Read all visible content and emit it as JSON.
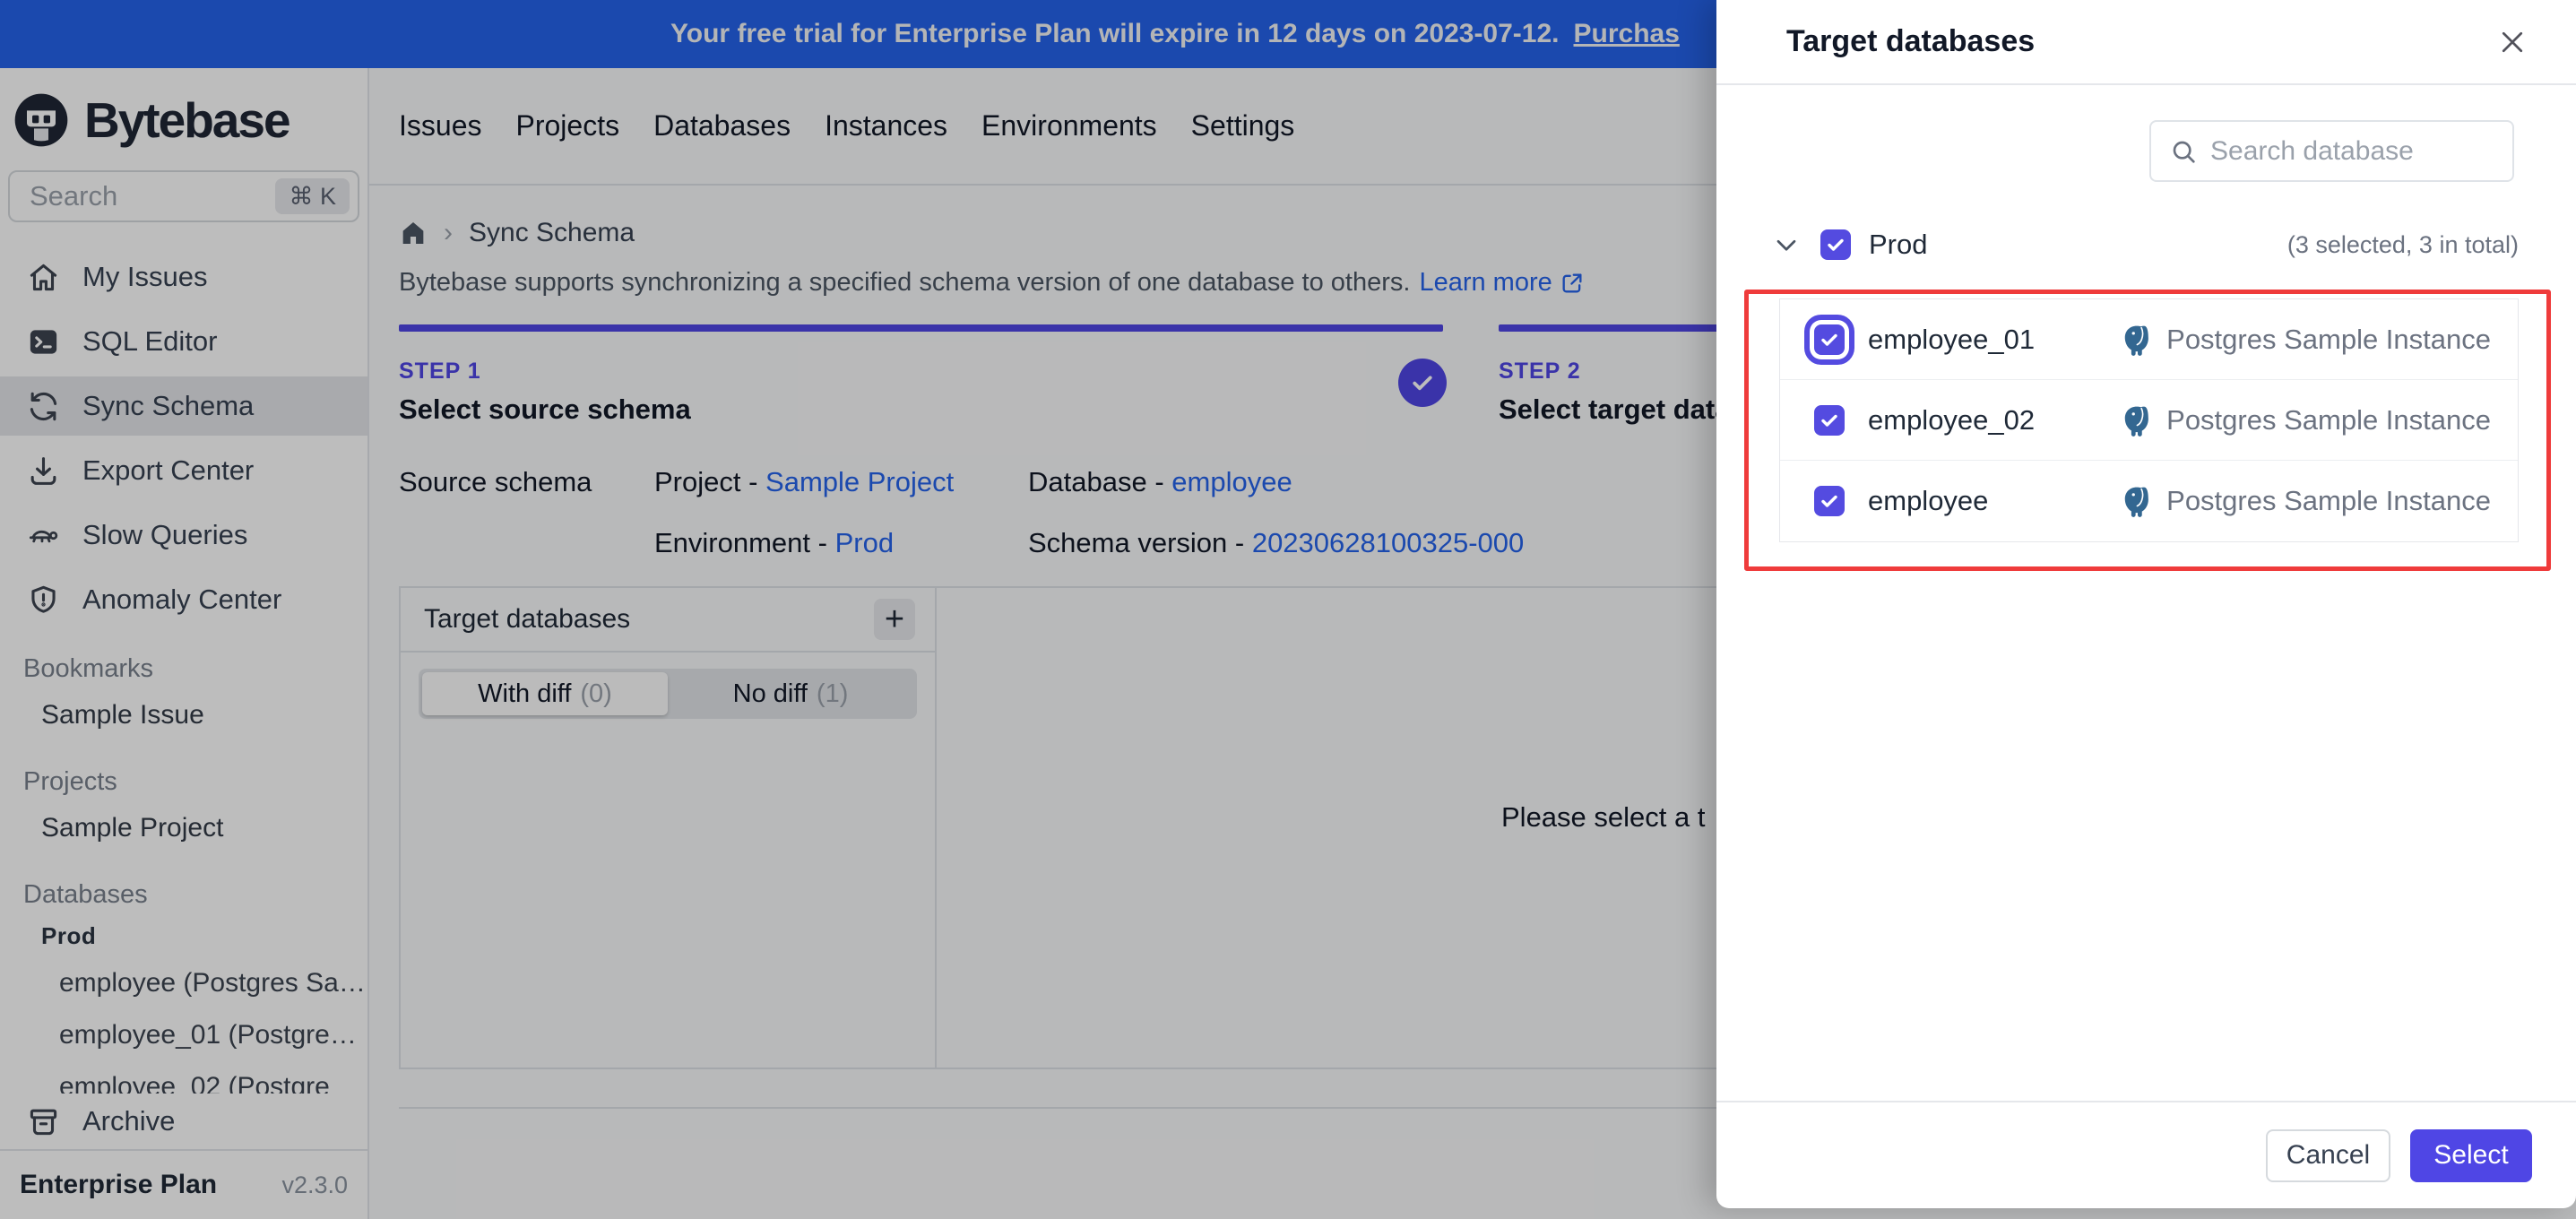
{
  "banner": {
    "text": "Your free trial for Enterprise Plan will expire in 12 days on 2023-07-12.",
    "link_label": "Purchas"
  },
  "sidebar": {
    "logo_text": "Bytebase",
    "search": {
      "placeholder": "Search",
      "shortcut": "⌘ K"
    },
    "nav": [
      {
        "label": "My Issues",
        "icon": "home-icon"
      },
      {
        "label": "SQL Editor",
        "icon": "terminal-icon"
      },
      {
        "label": "Sync Schema",
        "icon": "sync-icon",
        "active": true
      },
      {
        "label": "Export Center",
        "icon": "download-icon"
      },
      {
        "label": "Slow Queries",
        "icon": "turtle-icon"
      },
      {
        "label": "Anomaly Center",
        "icon": "shield-icon"
      }
    ],
    "sections": {
      "bookmarks": {
        "label": "Bookmarks",
        "items": [
          "Sample Issue"
        ]
      },
      "projects": {
        "label": "Projects",
        "items": [
          "Sample Project"
        ]
      },
      "databases": {
        "label": "Databases",
        "group": "Prod",
        "items": [
          "employee (Postgres Sa…",
          "employee_01 (Postgre…",
          "employee_02 (Postgre"
        ]
      }
    },
    "archive_label": "Archive",
    "footer": {
      "plan": "Enterprise Plan",
      "version": "v2.3.0"
    }
  },
  "topnav": {
    "items": [
      "Issues",
      "Projects",
      "Databases",
      "Instances",
      "Environments",
      "Settings"
    ]
  },
  "page": {
    "breadcrumb": "Sync Schema",
    "description": "Bytebase supports synchronizing a specified schema version of one database to others.",
    "learn_more": "Learn more",
    "steps": {
      "step1_label": "STEP 1",
      "step1_title": "Select source schema",
      "step2_label": "STEP 2",
      "step2_title": "Select target datab"
    },
    "source_schema": {
      "label": "Source schema",
      "project_label": "Project - ",
      "project_value": "Sample Project",
      "environment_label": "Environment - ",
      "environment_value": "Prod",
      "database_label": "Database - ",
      "database_value": "employee",
      "version_label": "Schema version - ",
      "version_value": "20230628100325-000"
    },
    "panel": {
      "title": "Target databases",
      "add_label": "+",
      "tabs": {
        "with_diff": "With diff",
        "with_diff_count": "(0)",
        "no_diff": "No diff",
        "no_diff_count": "(1)"
      },
      "placeholder": "Please select a t"
    }
  },
  "drawer": {
    "title": "Target databases",
    "search_placeholder": "Search database",
    "group": {
      "name": "Prod",
      "summary": "(3 selected, 3 in total)"
    },
    "databases": [
      {
        "name": "employee_01",
        "instance": "Postgres Sample Instance",
        "checked": true
      },
      {
        "name": "employee_02",
        "instance": "Postgres Sample Instance",
        "checked": true
      },
      {
        "name": "employee",
        "instance": "Postgres Sample Instance",
        "checked": true
      }
    ],
    "footer": {
      "cancel": "Cancel",
      "select": "Select"
    }
  },
  "colors": {
    "accent": "#4f46e5",
    "checkbox_indigo": "#544be0",
    "banner_blue": "#2563eb",
    "link_blue": "#2563eb",
    "annotation_red": "#ef3b3b",
    "postgres_blue": "#336791"
  }
}
